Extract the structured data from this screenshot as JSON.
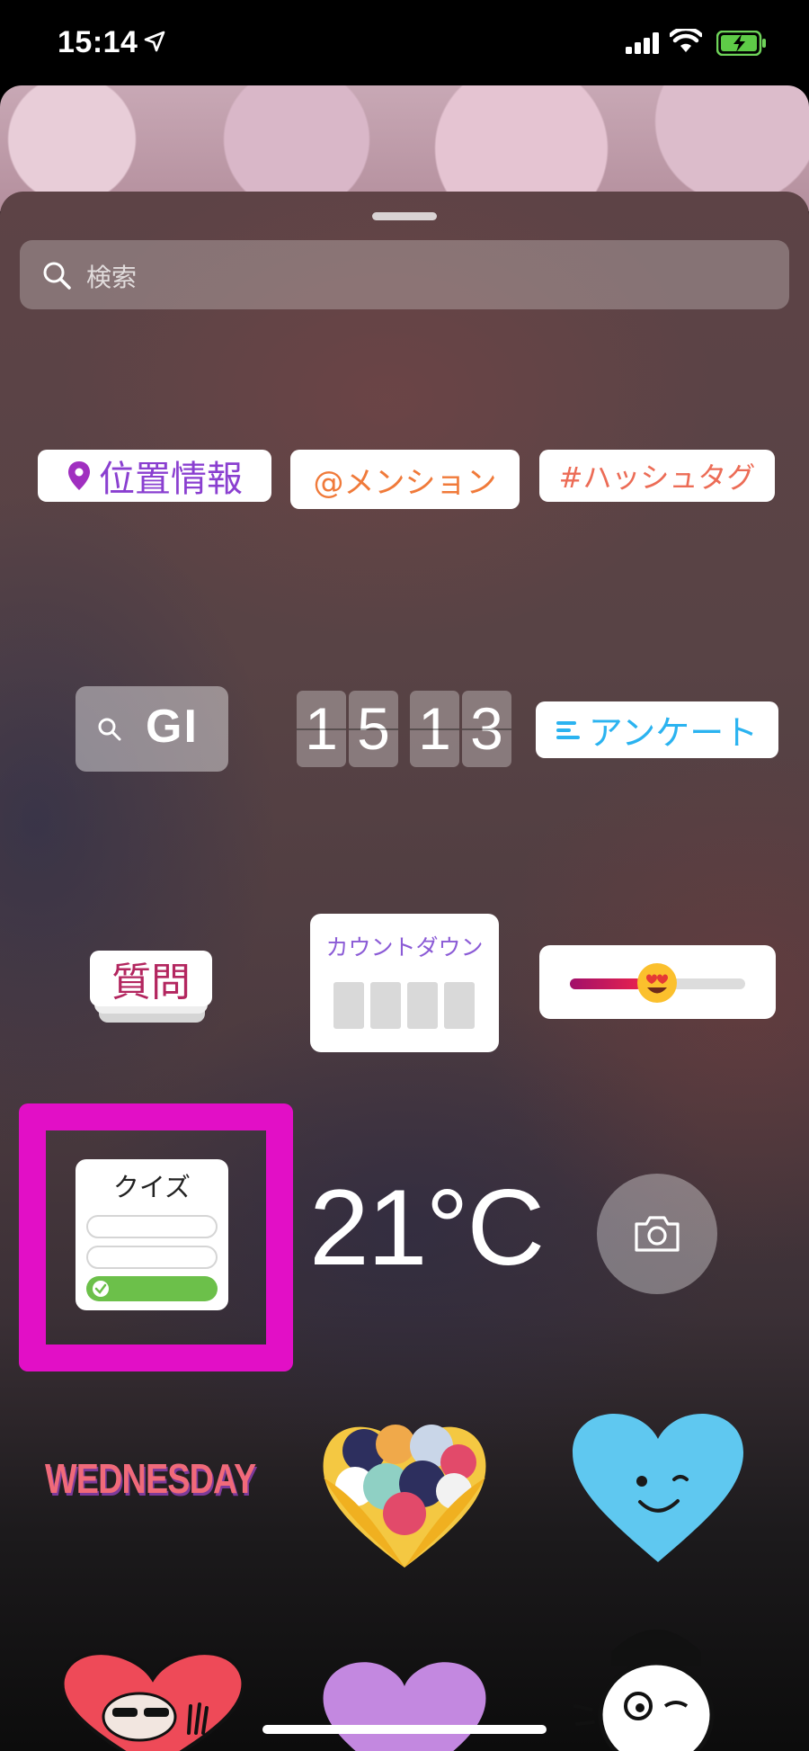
{
  "status_bar": {
    "time": "15:14"
  },
  "search": {
    "placeholder": "検索"
  },
  "stickers": {
    "location": "位置情報",
    "mention": "@メンション",
    "hashtag": "#ハッシュタグ",
    "gif": "GI",
    "clock_hours": [
      "1",
      "5"
    ],
    "clock_minutes": [
      "1",
      "3"
    ],
    "poll": "アンケート",
    "question": "質問",
    "countdown": "カウントダウン",
    "quiz": "クイズ",
    "temperature": "21°C",
    "weekday": "WEDNESDAY"
  },
  "colors": {
    "highlight": "#e20fc6",
    "location_text": "#8a3fd0",
    "poll_text": "#2bb3f0",
    "quiz_correct": "#6cc04a"
  }
}
